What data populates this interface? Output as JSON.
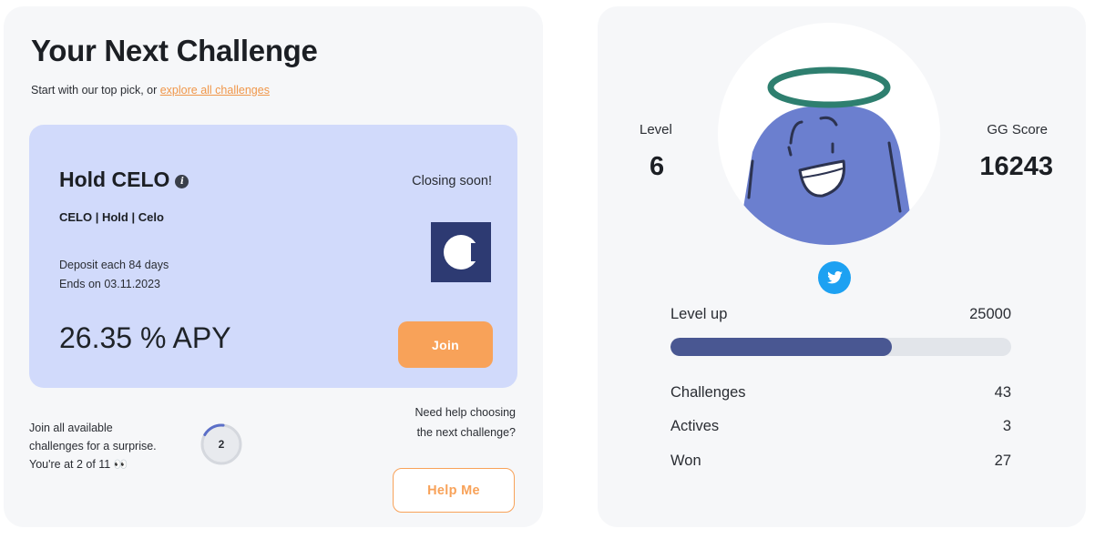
{
  "challenge": {
    "title": "Your Next Challenge",
    "subtitle_prefix": "Start with our top pick, or ",
    "subtitle_link": "explore all challenges",
    "pick": {
      "name": "Hold CELO",
      "info_icon": "info-icon",
      "tags": "CELO | Hold | Celo",
      "closing": "Closing soon!",
      "deposit": "Deposit each 84 days",
      "ends": "Ends on 03.11.2023",
      "apy": "26.35 % APY",
      "join_label": "Join",
      "logo_icon": "celo-logo"
    },
    "surprise": {
      "line1": "Join all available",
      "line2": "challenges for a surprise.",
      "line3": "You're at 2 of 11 👀",
      "count": "2",
      "joined": 2,
      "total": 11
    },
    "help": {
      "line1": "Need help choosing",
      "line2": "the next challenge?",
      "button_label": "Help Me"
    }
  },
  "profile": {
    "level_label": "Level",
    "level_value": "6",
    "score_label": "GG Score",
    "score_value": "16243",
    "avatar_icon": "halo-character-avatar",
    "social_icon": "twitter-icon",
    "level_up_label": "Level up",
    "level_up_value": "25000",
    "level_progress": 0.65,
    "stats": {
      "challenges_label": "Challenges",
      "challenges_value": "43",
      "actives_label": "Actives",
      "actives_value": "3",
      "won_label": "Won",
      "won_value": "27"
    }
  },
  "colors": {
    "accent_orange": "#f8a259",
    "pick_bg": "#d1dafb",
    "progress_fill": "#495792",
    "twitter_blue": "#1da1f2",
    "celo_navy": "#2d3a72",
    "avatar_body": "#6b7fcf",
    "halo_green": "#2e7f6f"
  }
}
